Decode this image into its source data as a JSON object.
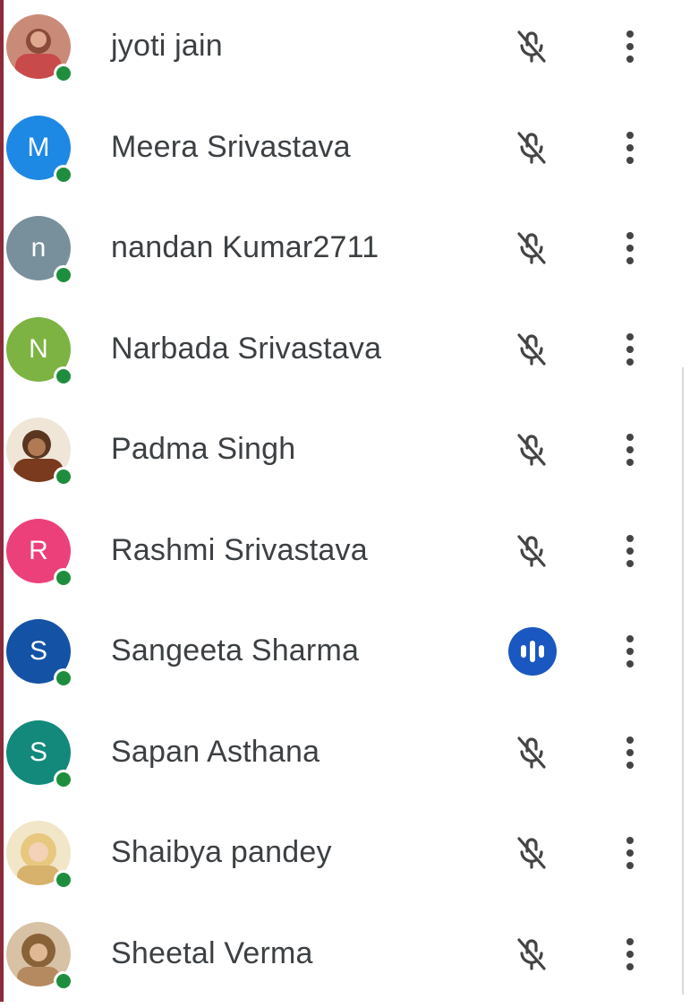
{
  "participants": [
    {
      "name": "jyoti jain",
      "initial": "",
      "avatar_color": "#b86a5a",
      "avatar_type": "photo",
      "status": "muted"
    },
    {
      "name": "Meera Srivastava",
      "initial": "M",
      "avatar_color": "#1e88e5",
      "avatar_type": "initial",
      "status": "muted"
    },
    {
      "name": "nandan Kumar2711",
      "initial": "n",
      "avatar_color": "#78909c",
      "avatar_type": "initial",
      "status": "muted"
    },
    {
      "name": "Narbada Srivastava",
      "initial": "N",
      "avatar_color": "#7cb342",
      "avatar_type": "initial",
      "status": "muted"
    },
    {
      "name": "Padma Singh",
      "initial": "",
      "avatar_color": "#8d5a3c",
      "avatar_type": "photo",
      "status": "muted"
    },
    {
      "name": "Rashmi Srivastava",
      "initial": "R",
      "avatar_color": "#ec407a",
      "avatar_type": "initial",
      "status": "muted"
    },
    {
      "name": "Sangeeta Sharma",
      "initial": "S",
      "avatar_color": "#1452a6",
      "avatar_type": "initial",
      "status": "speaking"
    },
    {
      "name": "Sapan Asthana",
      "initial": "S",
      "avatar_color": "#13897b",
      "avatar_type": "initial",
      "status": "muted"
    },
    {
      "name": "Shaibya pandey",
      "initial": "",
      "avatar_color": "#e0c48a",
      "avatar_type": "photo",
      "status": "muted"
    },
    {
      "name": "Sheetal Verma",
      "initial": "",
      "avatar_color": "#9a7650",
      "avatar_type": "photo",
      "status": "muted"
    }
  ],
  "icons": {
    "mic_off": "mic-off-icon",
    "speaking": "speaking-indicator-icon",
    "more": "more-vert-icon",
    "online": "online-status-dot"
  },
  "colors": {
    "online_dot": "#1e8e3e",
    "speaking_badge": "#1a57c0",
    "name_text": "#3c4043",
    "mic_icon": "#444444"
  }
}
